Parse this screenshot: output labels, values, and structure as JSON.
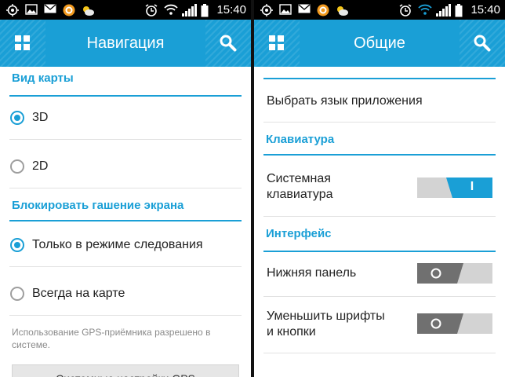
{
  "status_bar": {
    "time": "15:40",
    "icons": [
      "gps-target-icon",
      "image-icon",
      "mail-icon",
      "app-notification-icon",
      "weather-icon",
      "alarm-clock-icon",
      "wifi-icon",
      "signal-icon",
      "battery-icon"
    ]
  },
  "colors": {
    "accent": "#1a9fd6",
    "toggle_off": "#707070",
    "toggle_track": "#d3d3d3",
    "status_bar": "#000000"
  },
  "left_screen": {
    "title": "Навигация",
    "section_map_view": "Вид карты",
    "map_view_options": [
      {
        "label": "3D",
        "selected": true
      },
      {
        "label": "2D",
        "selected": false
      }
    ],
    "section_screen_lock": "Блокировать гашение экрана",
    "screen_lock_options": [
      {
        "label": "Только в режиме следования",
        "selected": true
      },
      {
        "label": "Всегда на карте",
        "selected": false
      }
    ],
    "gps_note_line1": "Использование GPS-приёмника разрешено  в",
    "gps_note_line2": "системе.",
    "gps_button": "Системные настройки GPS"
  },
  "right_screen": {
    "title": "Общие",
    "language_item": "Выбрать язык приложения",
    "section_keyboard": "Клавиатура",
    "system_keyboard_line1": "Системная",
    "system_keyboard_line2": "клавиатура",
    "system_keyboard_toggle": {
      "state": "on",
      "text": "I"
    },
    "section_interface": "Интерфейс",
    "bottom_panel": "Нижняя панель",
    "bottom_panel_toggle": {
      "state": "off",
      "text": "O"
    },
    "reduce_fonts_line1": "Уменьшить шрифты",
    "reduce_fonts_line2": "и кнопки",
    "reduce_fonts_toggle": {
      "state": "off",
      "text": "O"
    }
  }
}
